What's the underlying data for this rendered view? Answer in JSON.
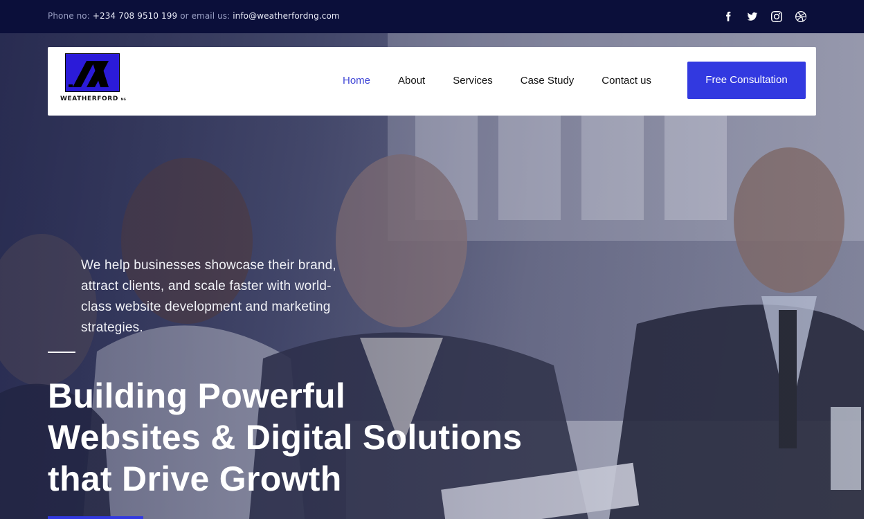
{
  "topbar": {
    "phone_label": "Phone no:",
    "phone": "+234 708 9510 199",
    "or_email": "or email us:",
    "email": "info@weatherfordng.com",
    "socials": [
      {
        "icon": "facebook-icon"
      },
      {
        "icon": "twitter-icon"
      },
      {
        "icon": "instagram-icon"
      },
      {
        "icon": "dribbble-icon"
      }
    ]
  },
  "brand": {
    "name": "WEATHERFORD",
    "suffix": "NG"
  },
  "nav": {
    "items": [
      {
        "label": "Home",
        "active": true
      },
      {
        "label": "About"
      },
      {
        "label": "Services"
      },
      {
        "label": "Case Study"
      },
      {
        "label": "Contact us"
      }
    ],
    "cta": "Free Consultation"
  },
  "hero": {
    "tagline": "We help businesses showcase their brand, attract clients, and scale faster with world-class website development and marketing strategies.",
    "headline_line1": "Building Powerful",
    "headline_line2": "Websites & Digital Solutions",
    "headline_line3": "that Drive Growth"
  },
  "colors": {
    "topbar_bg": "#0b0f3a",
    "accent": "#3239e0",
    "nav_active": "#3f46d6"
  }
}
